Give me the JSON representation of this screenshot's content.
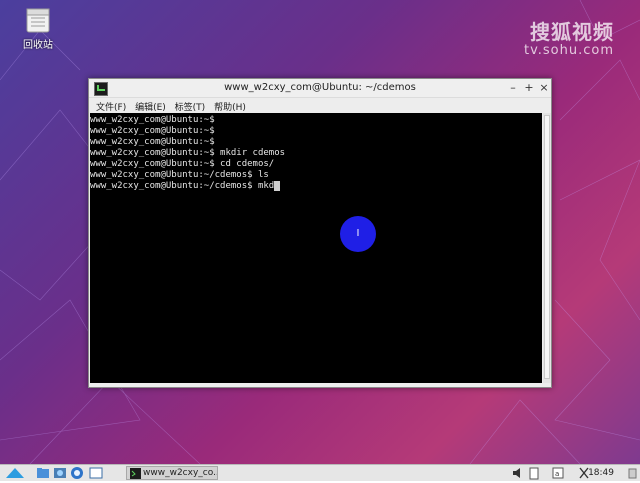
{
  "desktop": {
    "trash_label": "回收站"
  },
  "watermark": {
    "title": "搜狐视频",
    "url": "tv.sohu.com"
  },
  "terminal_window": {
    "title": "www_w2cxy_com@Ubuntu: ~/cdemos",
    "buttons": {
      "minimize": "–",
      "maximize": "+",
      "close": "×"
    },
    "menu": [
      "文件(F)",
      "编辑(E)",
      "标签(T)",
      "帮助(H)"
    ],
    "lines": [
      "www_w2cxy_com@Ubuntu:~$",
      "www_w2cxy_com@Ubuntu:~$",
      "www_w2cxy_com@Ubuntu:~$",
      "www_w2cxy_com@Ubuntu:~$ mkdir cdemos",
      "www_w2cxy_com@Ubuntu:~$ cd cdemos/",
      "www_w2cxy_com@Ubuntu:~/cdemos$ ls",
      "www_w2cxy_com@Ubuntu:~/cdemos$ mkd"
    ]
  },
  "cursor_marker": {
    "glyph": "I"
  },
  "taskbar": {
    "task_label": "www_w2cxy_co...",
    "clock": "18:49"
  },
  "colors": {
    "terminal_bg": "#000000",
    "click_marker": "#1f1fe6"
  }
}
